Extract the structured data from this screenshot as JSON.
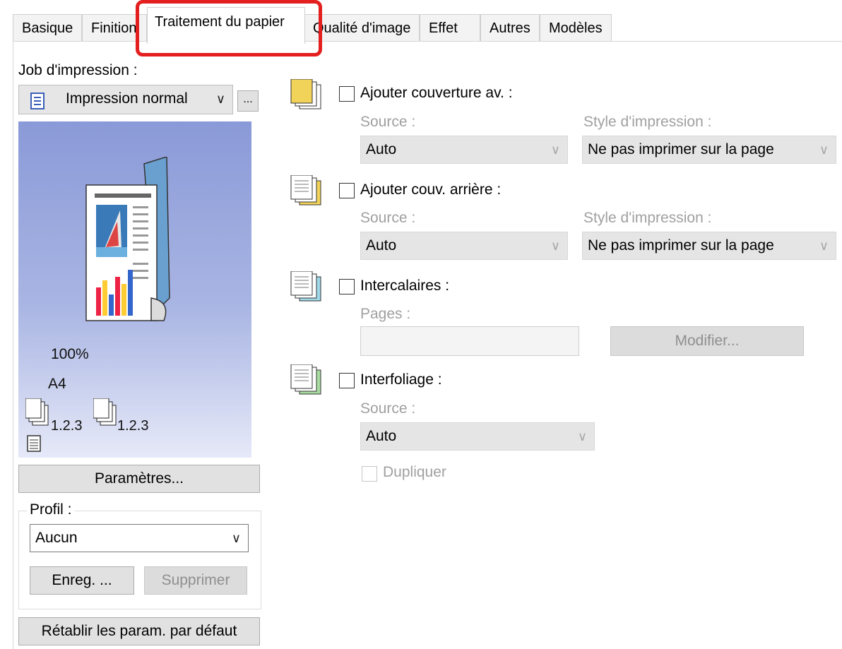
{
  "tabs": [
    {
      "label": "Basique"
    },
    {
      "label": "Finition"
    },
    {
      "label": "Traitement du papier"
    },
    {
      "label": "Qualité d'image"
    },
    {
      "label": "Effet"
    },
    {
      "label": "Autres"
    },
    {
      "label": "Modèles"
    }
  ],
  "left": {
    "job_label": "Job d'impression :",
    "job_value": "Impression normal",
    "more_label": "...",
    "zoom": "100%",
    "paper_size": "A4",
    "collate_1": "1.2.3",
    "collate_2": "1.2.3",
    "settings_button": "Paramètres...",
    "profile_label": "Profil :",
    "profile_value": "Aucun",
    "save_button": "Enreg. ...",
    "delete_button": "Supprimer",
    "reset_button": "Rétablir les param. par défaut"
  },
  "front_cover": {
    "label": "Ajouter couverture av. :",
    "source_label": "Source :",
    "source_value": "Auto",
    "style_label": "Style d'impression :",
    "style_value": "Ne pas imprimer sur la page"
  },
  "back_cover": {
    "label": "Ajouter couv. arrière :",
    "source_label": "Source :",
    "source_value": "Auto",
    "style_label": "Style d'impression :",
    "style_value": "Ne pas imprimer sur la page"
  },
  "inserts": {
    "label": "Intercalaires :",
    "pages_label": "Pages :",
    "pages_value": "",
    "modify_button": "Modifier..."
  },
  "interleave": {
    "label": "Interfoliage :",
    "source_label": "Source :",
    "source_value": "Auto",
    "duplicate_label": "Dupliquer"
  },
  "colors": {
    "highlight": "#e3201f",
    "preview_top": "#8a9ad8",
    "preview_bottom": "#e6e9f8"
  }
}
